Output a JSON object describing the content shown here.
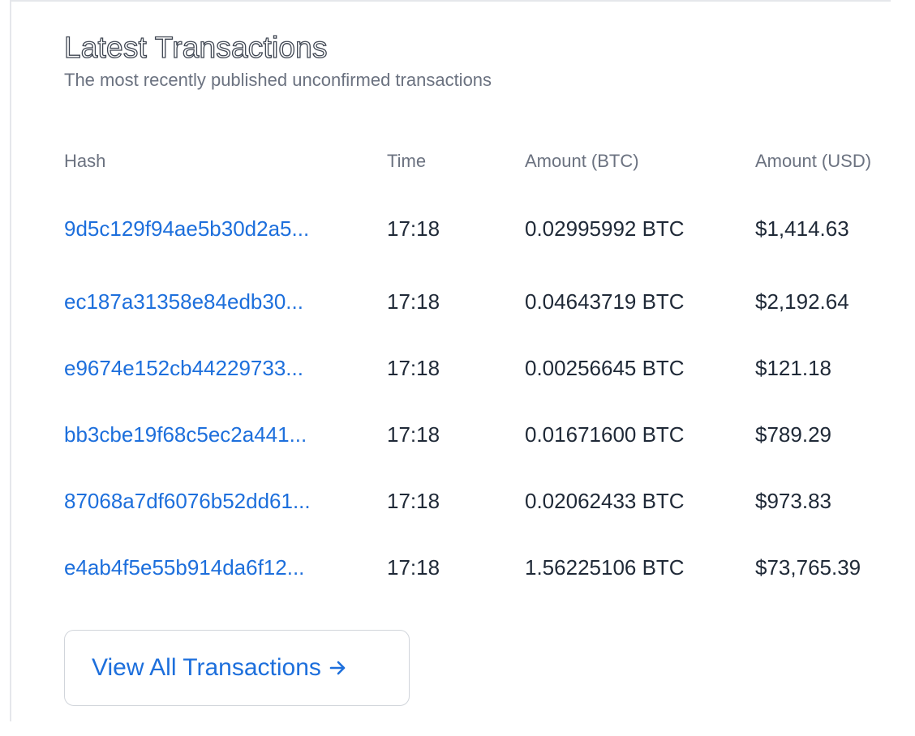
{
  "section": {
    "title": "Latest Transactions",
    "subtitle": "The most recently published unconfirmed transactions"
  },
  "table": {
    "columns": [
      "Hash",
      "Time",
      "Amount (BTC)",
      "Amount (USD)"
    ],
    "rows": [
      {
        "hash": "9d5c129f94ae5b30d2a5...",
        "time": "17:18",
        "btc": "0.02995992 BTC",
        "usd": "$1,414.63"
      },
      {
        "hash": "ec187a31358e84edb30...",
        "time": "17:18",
        "btc": "0.04643719 BTC",
        "usd": "$2,192.64"
      },
      {
        "hash": "e9674e152cb44229733...",
        "time": "17:18",
        "btc": "0.00256645 BTC",
        "usd": "$121.18"
      },
      {
        "hash": "bb3cbe19f68c5ec2a441...",
        "time": "17:18",
        "btc": "0.01671600 BTC",
        "usd": "$789.29"
      },
      {
        "hash": "87068a7df6076b52dd61...",
        "time": "17:18",
        "btc": "0.02062433 BTC",
        "usd": "$973.83"
      },
      {
        "hash": "e4ab4f5e55b914da6f12...",
        "time": "17:18",
        "btc": "1.56225106 BTC",
        "usd": "$73,765.39"
      }
    ]
  },
  "view_all": {
    "label": "View All Transactions",
    "icon": "arrow-right-icon"
  },
  "colors": {
    "link": "#1d6fdc",
    "muted": "#6b7280",
    "text": "#1f2937",
    "border": "#d1d5db"
  }
}
